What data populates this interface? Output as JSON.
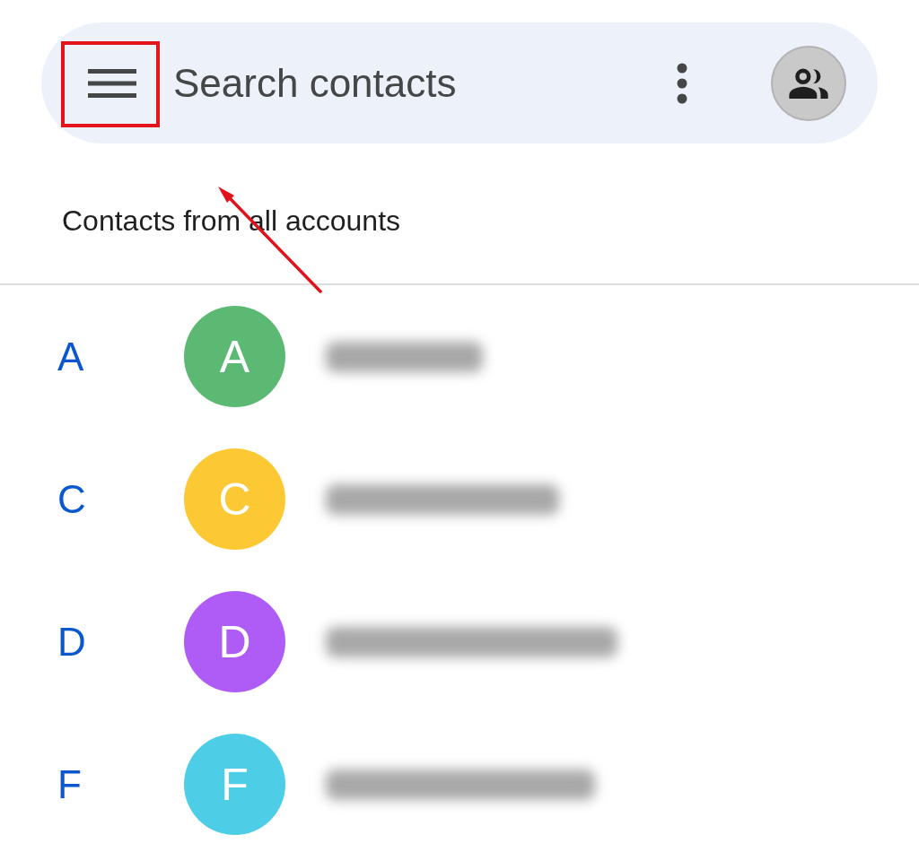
{
  "search_bar": {
    "placeholder": "Search contacts"
  },
  "header": "Contacts from all accounts",
  "contacts": [
    {
      "section": "A",
      "initial": "A",
      "color": "#5bb974",
      "name_redacted": true
    },
    {
      "section": "C",
      "initial": "C",
      "color": "#fcc934",
      "name_redacted": true
    },
    {
      "section": "D",
      "initial": "D",
      "color": "#af5cf7",
      "name_redacted": true
    },
    {
      "section": "F",
      "initial": "F",
      "color": "#4ecde6",
      "name_redacted": true
    }
  ],
  "annotations": {
    "menu_highlight": true,
    "arrow": true
  }
}
